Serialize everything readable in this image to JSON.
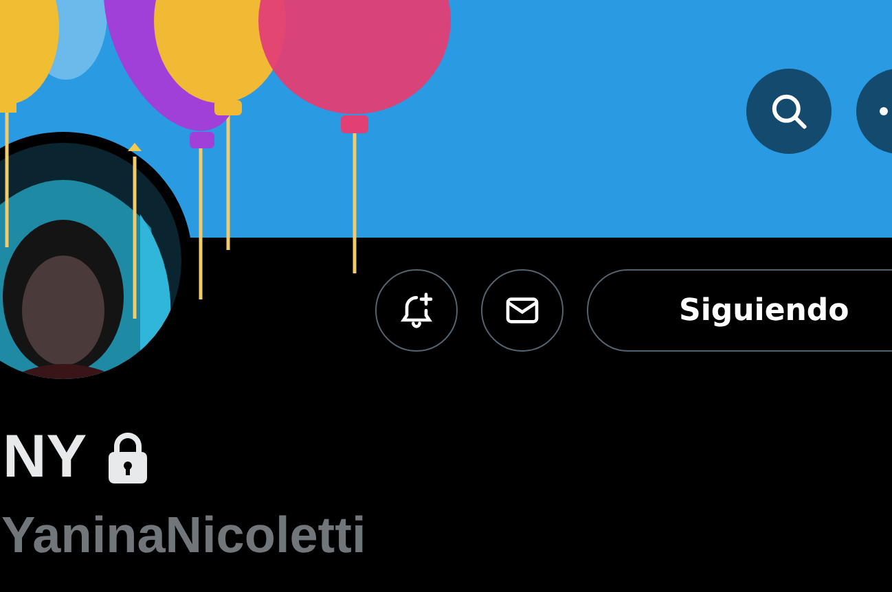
{
  "profile": {
    "name": "NY",
    "protected": true,
    "handle": "YaninaNicoletti"
  },
  "follow_button": {
    "label": "Siguiendo"
  }
}
